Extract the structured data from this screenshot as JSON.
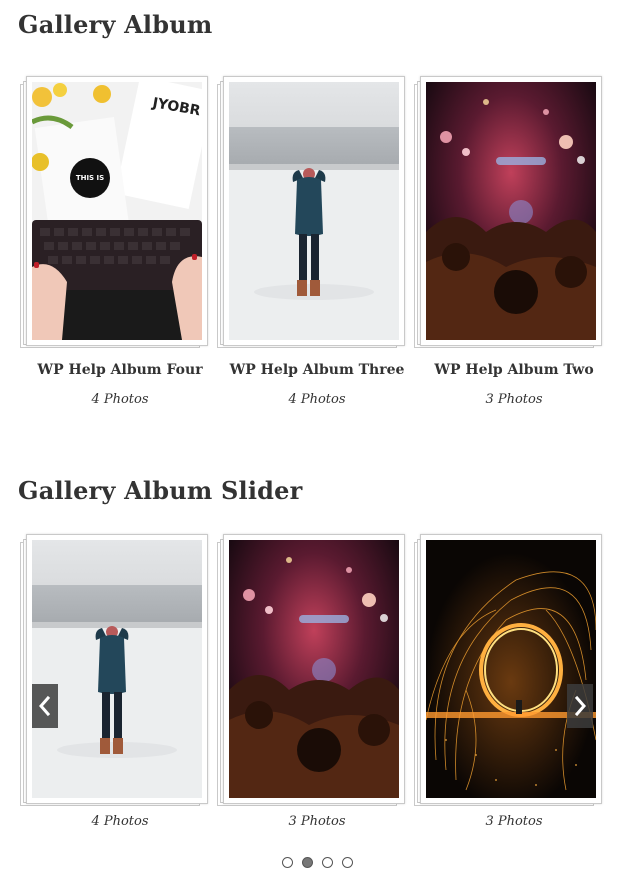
{
  "sections": {
    "album_title": "Gallery Album",
    "slider_title": "Gallery Album Slider"
  },
  "albums": [
    {
      "title": "WP Help Album Four",
      "count": "4 Photos",
      "image": "desk-keyboard-photo"
    },
    {
      "title": "WP Help Album Three",
      "count": "4 Photos",
      "image": "snow-beach-woman-photo"
    },
    {
      "title": "WP Help Album Two",
      "count": "3 Photos",
      "image": "concert-crowd-photo"
    }
  ],
  "slider": {
    "items": [
      {
        "count": "4 Photos",
        "image": "snow-beach-woman-photo"
      },
      {
        "count": "3 Photos",
        "image": "concert-crowd-photo"
      },
      {
        "count": "3 Photos",
        "image": "steel-wool-sparks-photo"
      }
    ],
    "prev_icon": "chevron-left-icon",
    "next_icon": "chevron-right-icon",
    "dots_total": 4,
    "dots_active": 2
  }
}
